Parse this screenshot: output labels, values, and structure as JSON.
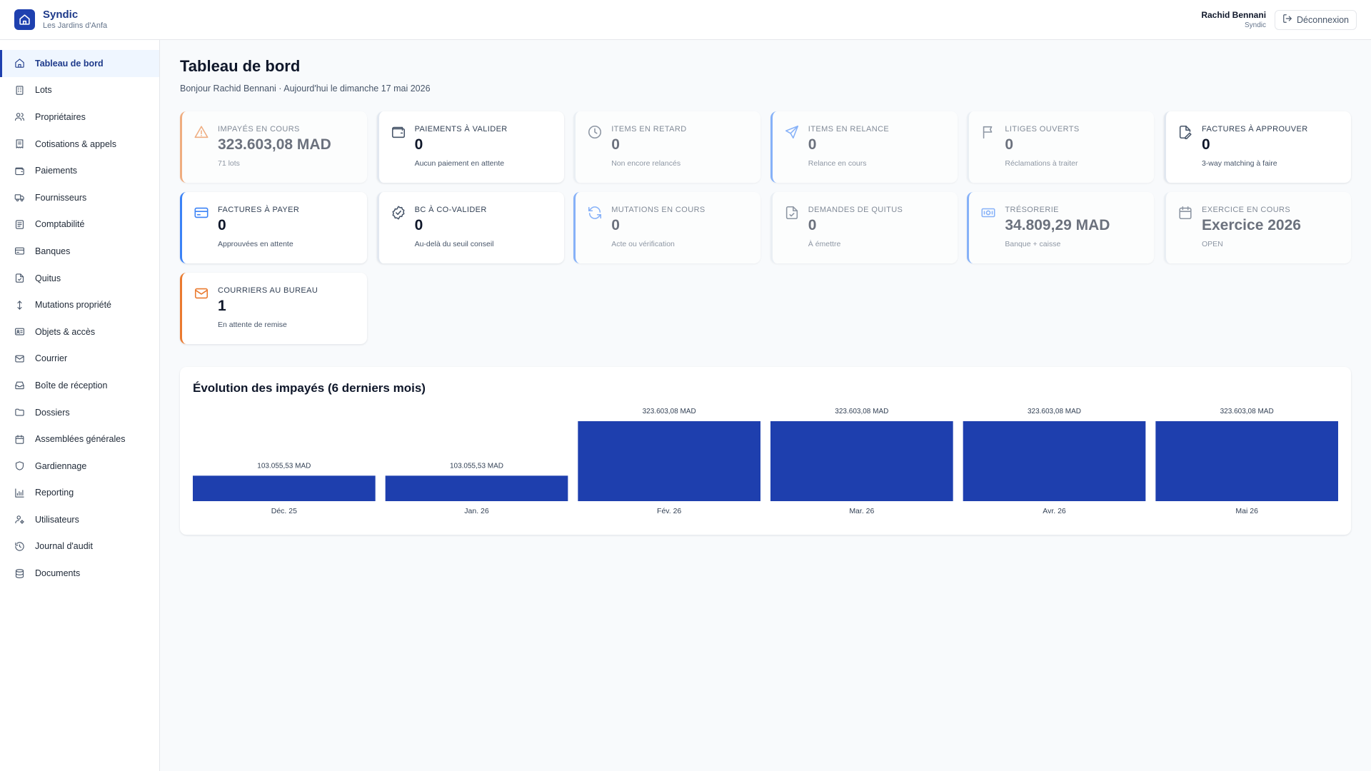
{
  "brand": {
    "name": "Syndic",
    "subtitle": "Les Jardins d'Anfa"
  },
  "user": {
    "name": "Rachid Bennani",
    "role": "Syndic",
    "logout_label": "Déconnexion"
  },
  "sidebar": {
    "items": [
      {
        "label": "Tableau de bord",
        "icon": "home-icon",
        "active": true
      },
      {
        "label": "Lots",
        "icon": "building-icon"
      },
      {
        "label": "Propriétaires",
        "icon": "users-icon"
      },
      {
        "label": "Cotisations & appels",
        "icon": "receipt-icon"
      },
      {
        "label": "Paiements",
        "icon": "wallet-icon"
      },
      {
        "label": "Fournisseurs",
        "icon": "truck-icon"
      },
      {
        "label": "Comptabilité",
        "icon": "ledger-icon"
      },
      {
        "label": "Banques",
        "icon": "credit-card-icon"
      },
      {
        "label": "Quitus",
        "icon": "file-check-icon"
      },
      {
        "label": "Mutations propriété",
        "icon": "arrows-vertical-icon"
      },
      {
        "label": "Objets & accès",
        "icon": "id-card-icon"
      },
      {
        "label": "Courrier",
        "icon": "mail-icon"
      },
      {
        "label": "Boîte de réception",
        "icon": "inbox-icon"
      },
      {
        "label": "Dossiers",
        "icon": "folder-icon"
      },
      {
        "label": "Assemblées générales",
        "icon": "calendar-icon"
      },
      {
        "label": "Gardiennage",
        "icon": "shield-icon"
      },
      {
        "label": "Reporting",
        "icon": "bar-chart-icon"
      },
      {
        "label": "Utilisateurs",
        "icon": "user-cog-icon"
      },
      {
        "label": "Journal d'audit",
        "icon": "history-icon"
      },
      {
        "label": "Documents",
        "icon": "database-icon"
      }
    ]
  },
  "page": {
    "title": "Tableau de bord",
    "subtitle": "Bonjour Rachid Bennani · Aujourd'hui le dimanche 17 mai 2026"
  },
  "cards": [
    {
      "label": "Impayés en cours",
      "value": "323.603,08 MAD",
      "hint": "71 lots",
      "icon": "alert-triangle-icon",
      "accent": "orange",
      "muted": true
    },
    {
      "label": "Paiements à valider",
      "value": "0",
      "hint": "Aucun paiement en attente",
      "icon": "wallet-icon",
      "accent": "none",
      "muted": false
    },
    {
      "label": "Items en retard",
      "value": "0",
      "hint": "Non encore relancés",
      "icon": "clock-icon",
      "accent": "none",
      "muted": true
    },
    {
      "label": "Items en relance",
      "value": "0",
      "hint": "Relance en cours",
      "icon": "send-icon",
      "accent": "blue",
      "muted": true
    },
    {
      "label": "Litiges ouverts",
      "value": "0",
      "hint": "Réclamations à traiter",
      "icon": "flag-icon",
      "accent": "none",
      "muted": true
    },
    {
      "label": "Factures à approuver",
      "value": "0",
      "hint": "3-way matching à faire",
      "icon": "file-edit-icon",
      "accent": "none",
      "muted": false
    },
    {
      "label": "Factures à payer",
      "value": "0",
      "hint": "Approuvées en attente",
      "icon": "credit-card-icon",
      "accent": "blue",
      "muted": false
    },
    {
      "label": "BC à co-valider",
      "value": "0",
      "hint": "Au-delà du seuil conseil",
      "icon": "badge-check-icon",
      "accent": "none",
      "muted": false
    },
    {
      "label": "Mutations en cours",
      "value": "0",
      "hint": "Acte ou vérification",
      "icon": "refresh-icon",
      "accent": "blue",
      "muted": true
    },
    {
      "label": "Demandes de quitus",
      "value": "0",
      "hint": "À émettre",
      "icon": "file-check-icon",
      "accent": "none",
      "muted": true
    },
    {
      "label": "Trésorerie",
      "value": "34.809,29 MAD",
      "hint": "Banque + caisse",
      "icon": "banknote-icon",
      "accent": "blue",
      "muted": true
    },
    {
      "label": "Exercice en cours",
      "value": "Exercice 2026",
      "hint": "OPEN",
      "icon": "calendar-icon",
      "accent": "none",
      "muted": true
    },
    {
      "label": "Courriers au bureau",
      "value": "1",
      "hint": "En attente de remise",
      "icon": "mail-icon",
      "accent": "orange",
      "muted": false
    }
  ],
  "colors": {
    "primary": "#1e40af",
    "orange": "#ea7a2f",
    "blue": "#3b82f6",
    "bar": "#1e3fae"
  },
  "chart_data": {
    "type": "bar",
    "title": "Évolution des impayés (6 derniers mois)",
    "categories": [
      "Déc. 25",
      "Jan. 26",
      "Fév. 26",
      "Mar. 26",
      "Avr. 26",
      "Mai 26"
    ],
    "values": [
      103055.53,
      103055.53,
      323603.08,
      323603.08,
      323603.08,
      323603.08
    ],
    "value_labels": [
      "103.055,53 MAD",
      "103.055,53 MAD",
      "323.603,08 MAD",
      "323.603,08 MAD",
      "323.603,08 MAD",
      "323.603,08 MAD"
    ],
    "xlabel": "",
    "ylabel": "",
    "ylim": [
      0,
      323603.08
    ],
    "grid": false,
    "legend": "none"
  }
}
